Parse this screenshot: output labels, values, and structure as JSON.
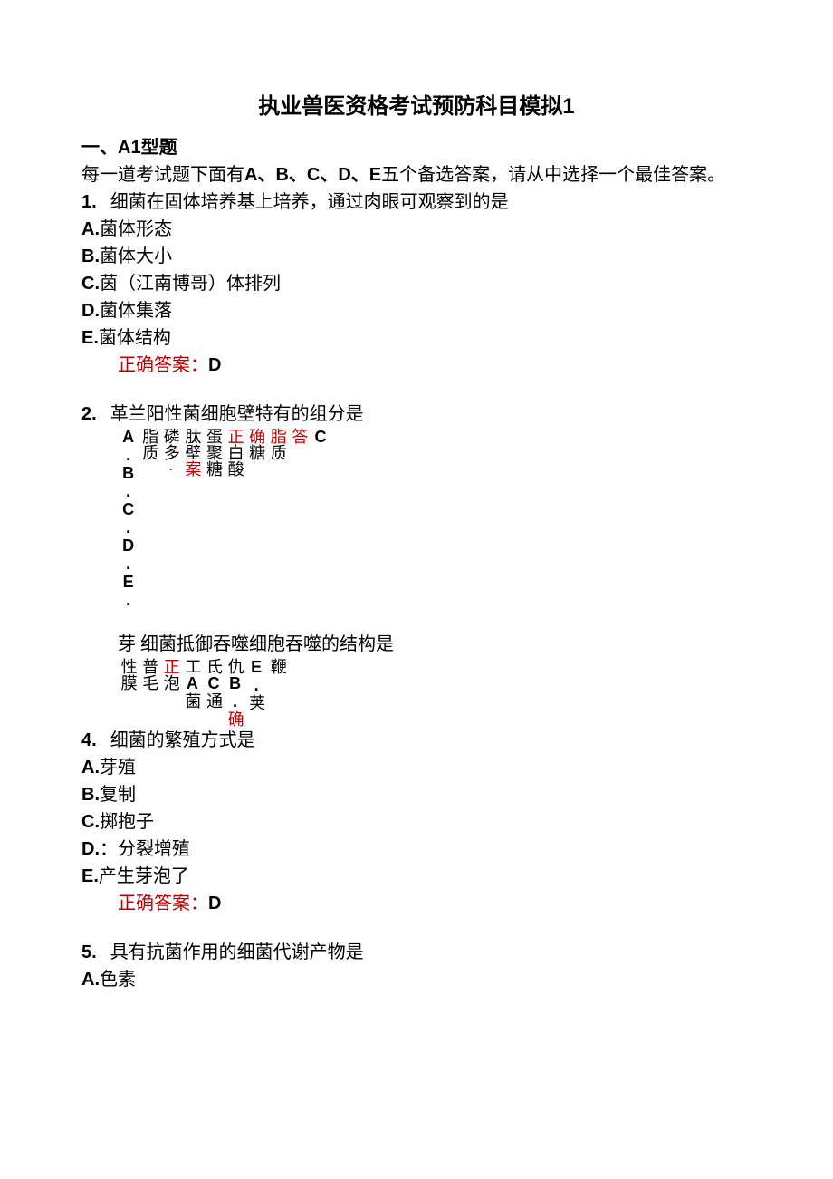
{
  "title": "执业兽医资格考试预防科目模拟1",
  "section": "一、A1型题",
  "instr_pre": "每一道考试题下面有",
  "instr_list": "A、B、C、D、E",
  "instr_post": "五个备选答案，请从中选择一个最佳答案。",
  "answer_prefix": "正确答案：",
  "q1": {
    "num": "1.",
    "stem": "细菌在固体培养基上培养，通过肉眼可观察到的是",
    "A": "菌体形态",
    "B": "菌体大小",
    "C": "茵（江南博哥）体排列",
    "D": "菌体集落",
    "E": "菌体结构",
    "ans": "D"
  },
  "q2": {
    "num": "2.",
    "stem": "革兰阳性菌细胞壁特有的组分是",
    "v_labels": "A.B.C.D.E.",
    "v_col1": "脂质",
    "v_col2": "磷多",
    "v_col3": "肽壁案",
    "v_col4": "蛋聚糖",
    "v_col5": "正白酸",
    "v_col6": "确糖",
    "v_col7": "脂质",
    "v_col8": "答",
    "v_col9": "C",
    "dot": "·"
  },
  "q3": {
    "pre": "芽",
    "stem": "细菌抵御吞噬细胞吞噬的结构是",
    "v_col1": "性膜",
    "v_col2": "普毛",
    "v_col3": "正泡",
    "v_col4": "工A菌",
    "v_col5": "氏C通",
    "v_col6": "仇B.确",
    "v_col7": "E.荚",
    "v_col8": "鞭"
  },
  "q4": {
    "num": "4.",
    "stem": "细菌的繁殖方式是",
    "A": "芽殖",
    "B": "复制",
    "C": "掷抱子",
    "D": "：分裂增殖",
    "E": "产生芽泡了",
    "ans": "D"
  },
  "q5": {
    "num": "5.",
    "stem": "具有抗菌作用的细菌代谢产物是",
    "A": "色素"
  }
}
